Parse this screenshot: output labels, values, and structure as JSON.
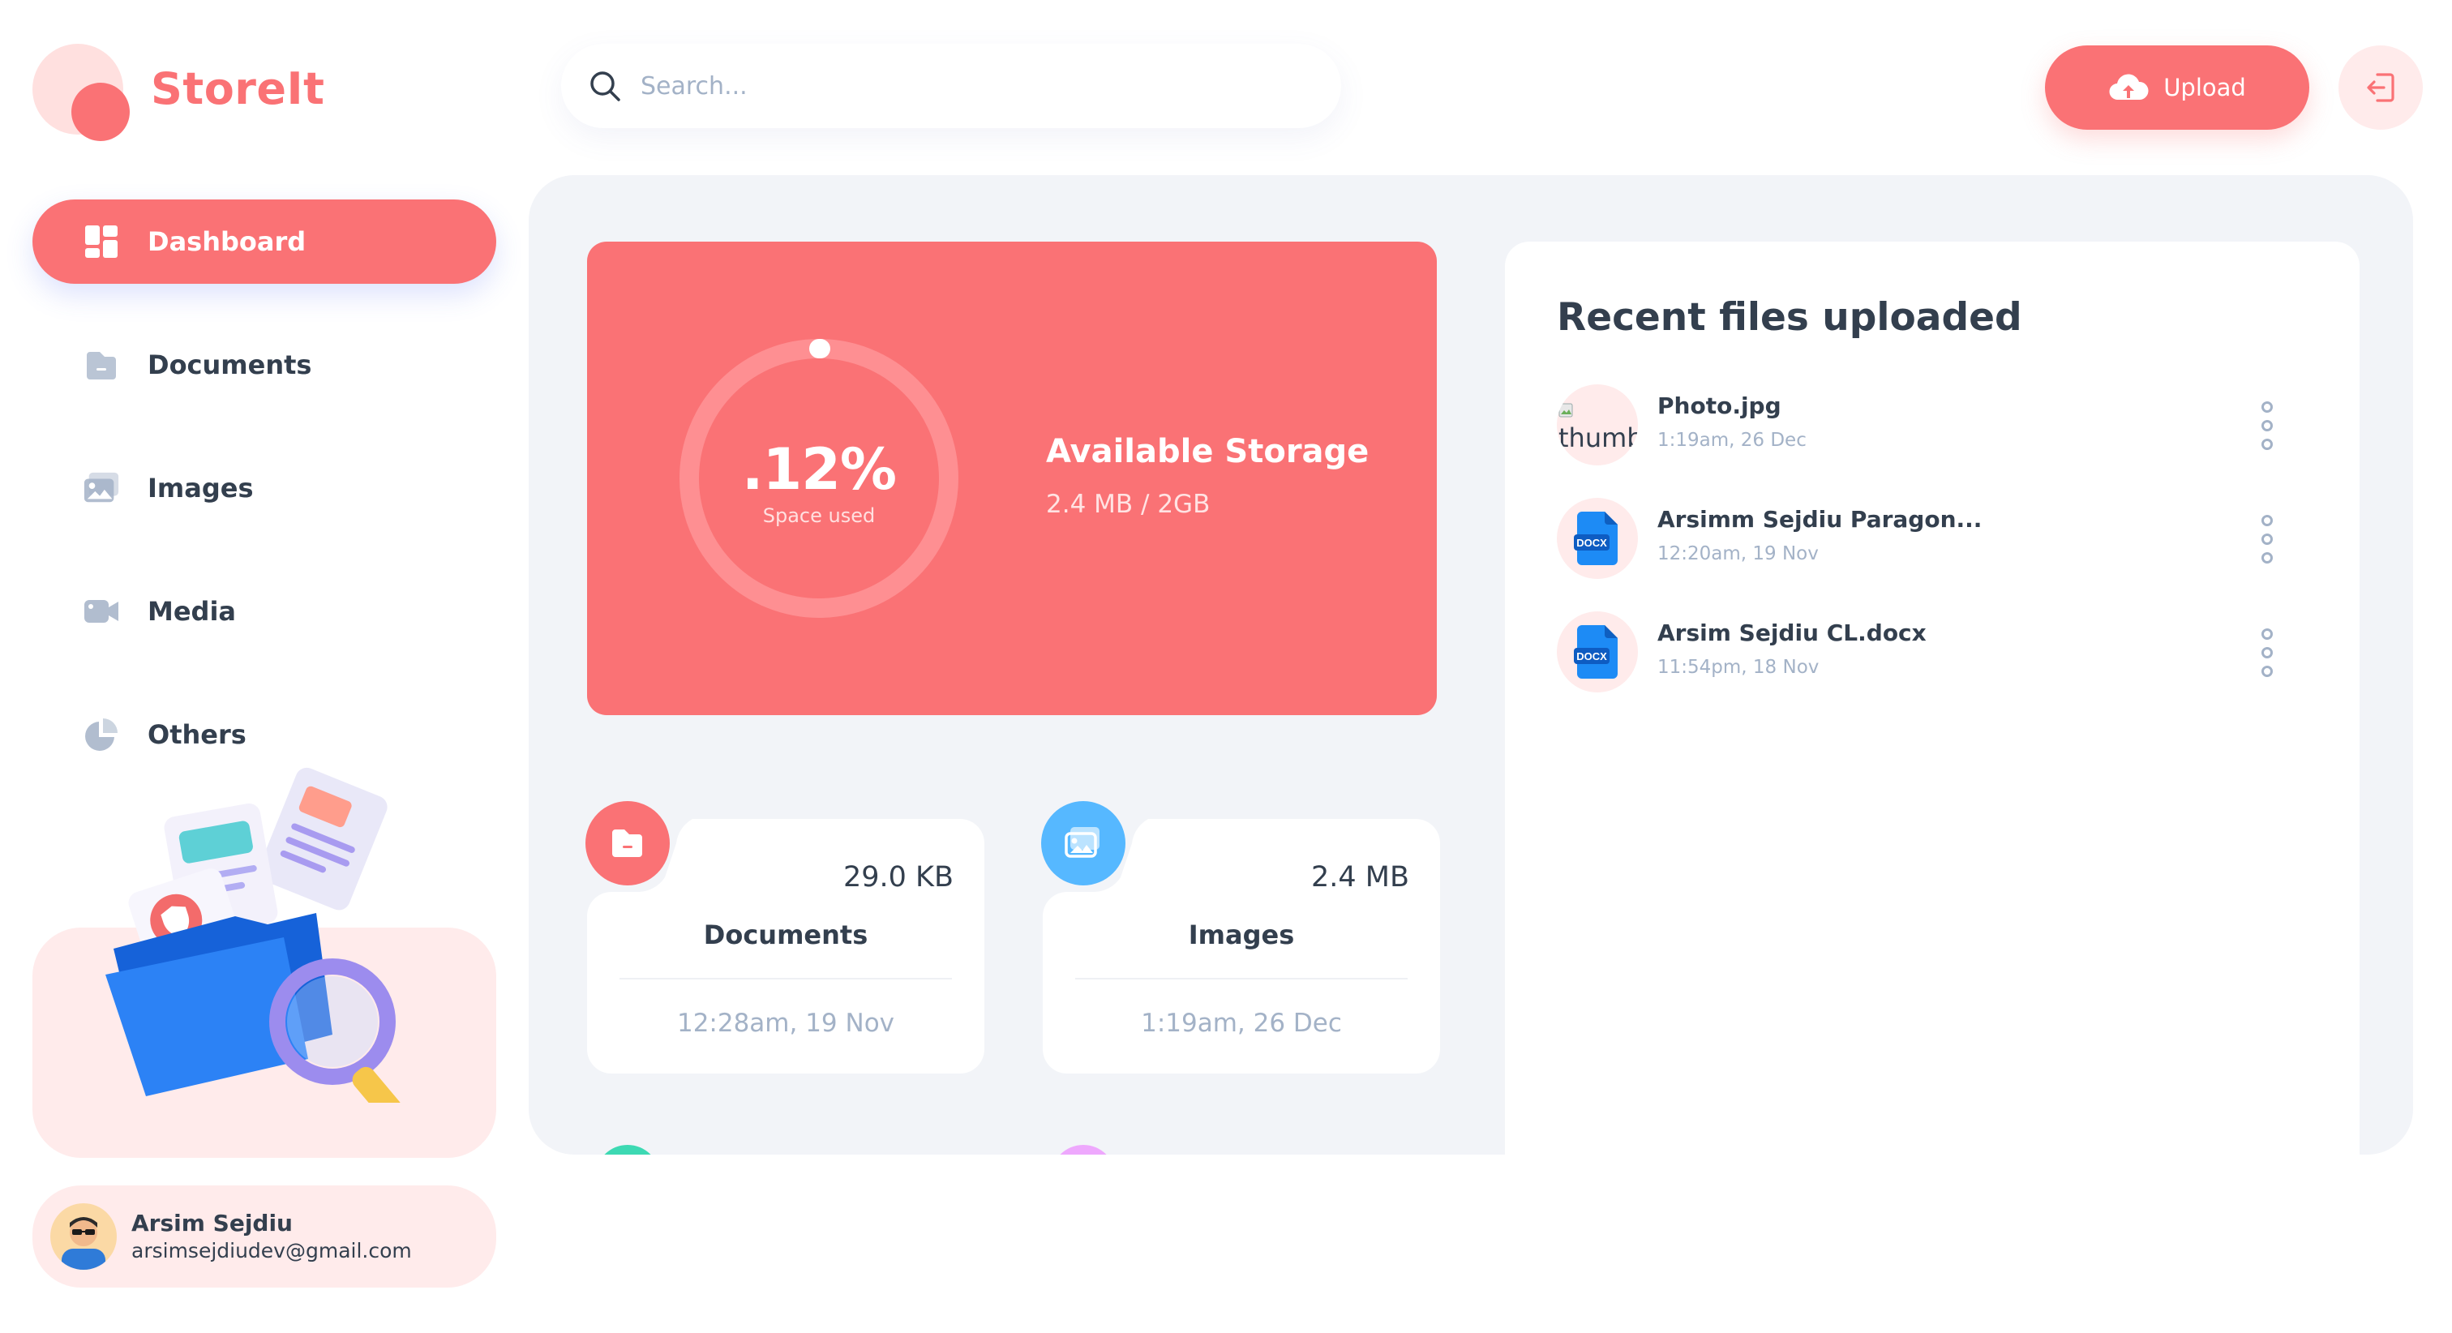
{
  "app": {
    "logo_text": "StoreIt"
  },
  "sidebar": {
    "items": [
      {
        "label": "Dashboard",
        "icon": "dashboard-icon",
        "active": true
      },
      {
        "label": "Documents",
        "icon": "documents-icon",
        "active": false
      },
      {
        "label": "Images",
        "icon": "images-icon",
        "active": false
      },
      {
        "label": "Media",
        "icon": "media-icon",
        "active": false
      },
      {
        "label": "Others",
        "icon": "others-icon",
        "active": false
      }
    ]
  },
  "user": {
    "name": "Arsim Sejdiu",
    "email": "arsimsejdiudev@gmail.com"
  },
  "header": {
    "search_placeholder": "Search...",
    "search_value": "",
    "upload_label": "Upload"
  },
  "storage": {
    "percent_label": ".12%",
    "percent_value": 0.12,
    "percent_caption": "Space used",
    "title": "Available Storage",
    "usage": "2.4 MB / 2GB"
  },
  "summary": [
    {
      "title": "Documents",
      "size": "29.0 KB",
      "date": "12:28am, 19 Nov",
      "icon": "documents-icon",
      "color": "#FA7275"
    },
    {
      "title": "Images",
      "size": "2.4 MB",
      "date": "1:19am, 26 Dec",
      "icon": "images-icon",
      "color": "#56B8FF"
    }
  ],
  "recent": {
    "title": "Recent files uploaded",
    "files": [
      {
        "name": "Photo.jpg",
        "date": "1:19am, 26 Dec",
        "thumb_alt": "thumb"
      },
      {
        "name": "Arsimm Sejdiu Paragon...",
        "date": "12:20am, 19 Nov",
        "badge": "DOCX"
      },
      {
        "name": "Arsim Sejdiu CL.docx",
        "date": "11:54pm, 18 Nov",
        "badge": "DOCX"
      }
    ]
  },
  "colors": {
    "brand": "#FA7275",
    "brand_light": "#FFEBEB",
    "panel_bg": "#F2F4F8",
    "text": "#333F4E",
    "muted": "#A3B2C7",
    "blue": "#56B8FF",
    "green": "#3DD9B3",
    "pink": "#EEA8FD"
  }
}
